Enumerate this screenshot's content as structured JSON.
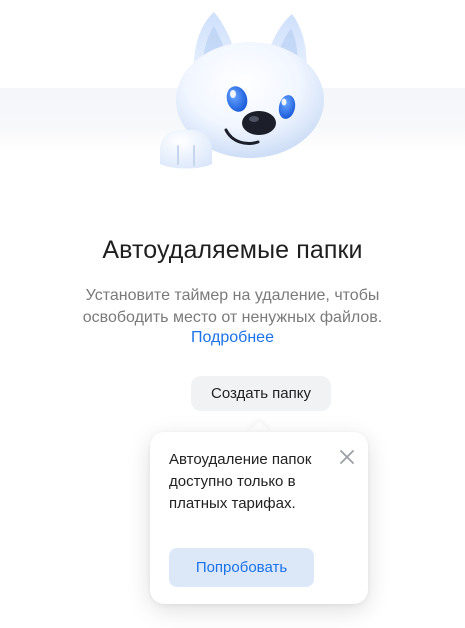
{
  "empty_state": {
    "title": "Автоудаляемые папки",
    "subtitle": "Установите таймер на удаление, чтобы освободить место от ненужных файлов.",
    "learn_more_link": "Подробнее",
    "create_folder_button": "Создать папку"
  },
  "popup": {
    "message": "Автоудаление папок доступно только в платных тарифах.",
    "try_button": "Попробовать",
    "close_icon": "close-icon"
  },
  "mascot": {
    "icon": "fox-mascot-illustration"
  },
  "colors": {
    "accent": "#1a73e8",
    "try_button_bg": "#dce8f8",
    "secondary_button_bg": "#f1f2f4"
  }
}
